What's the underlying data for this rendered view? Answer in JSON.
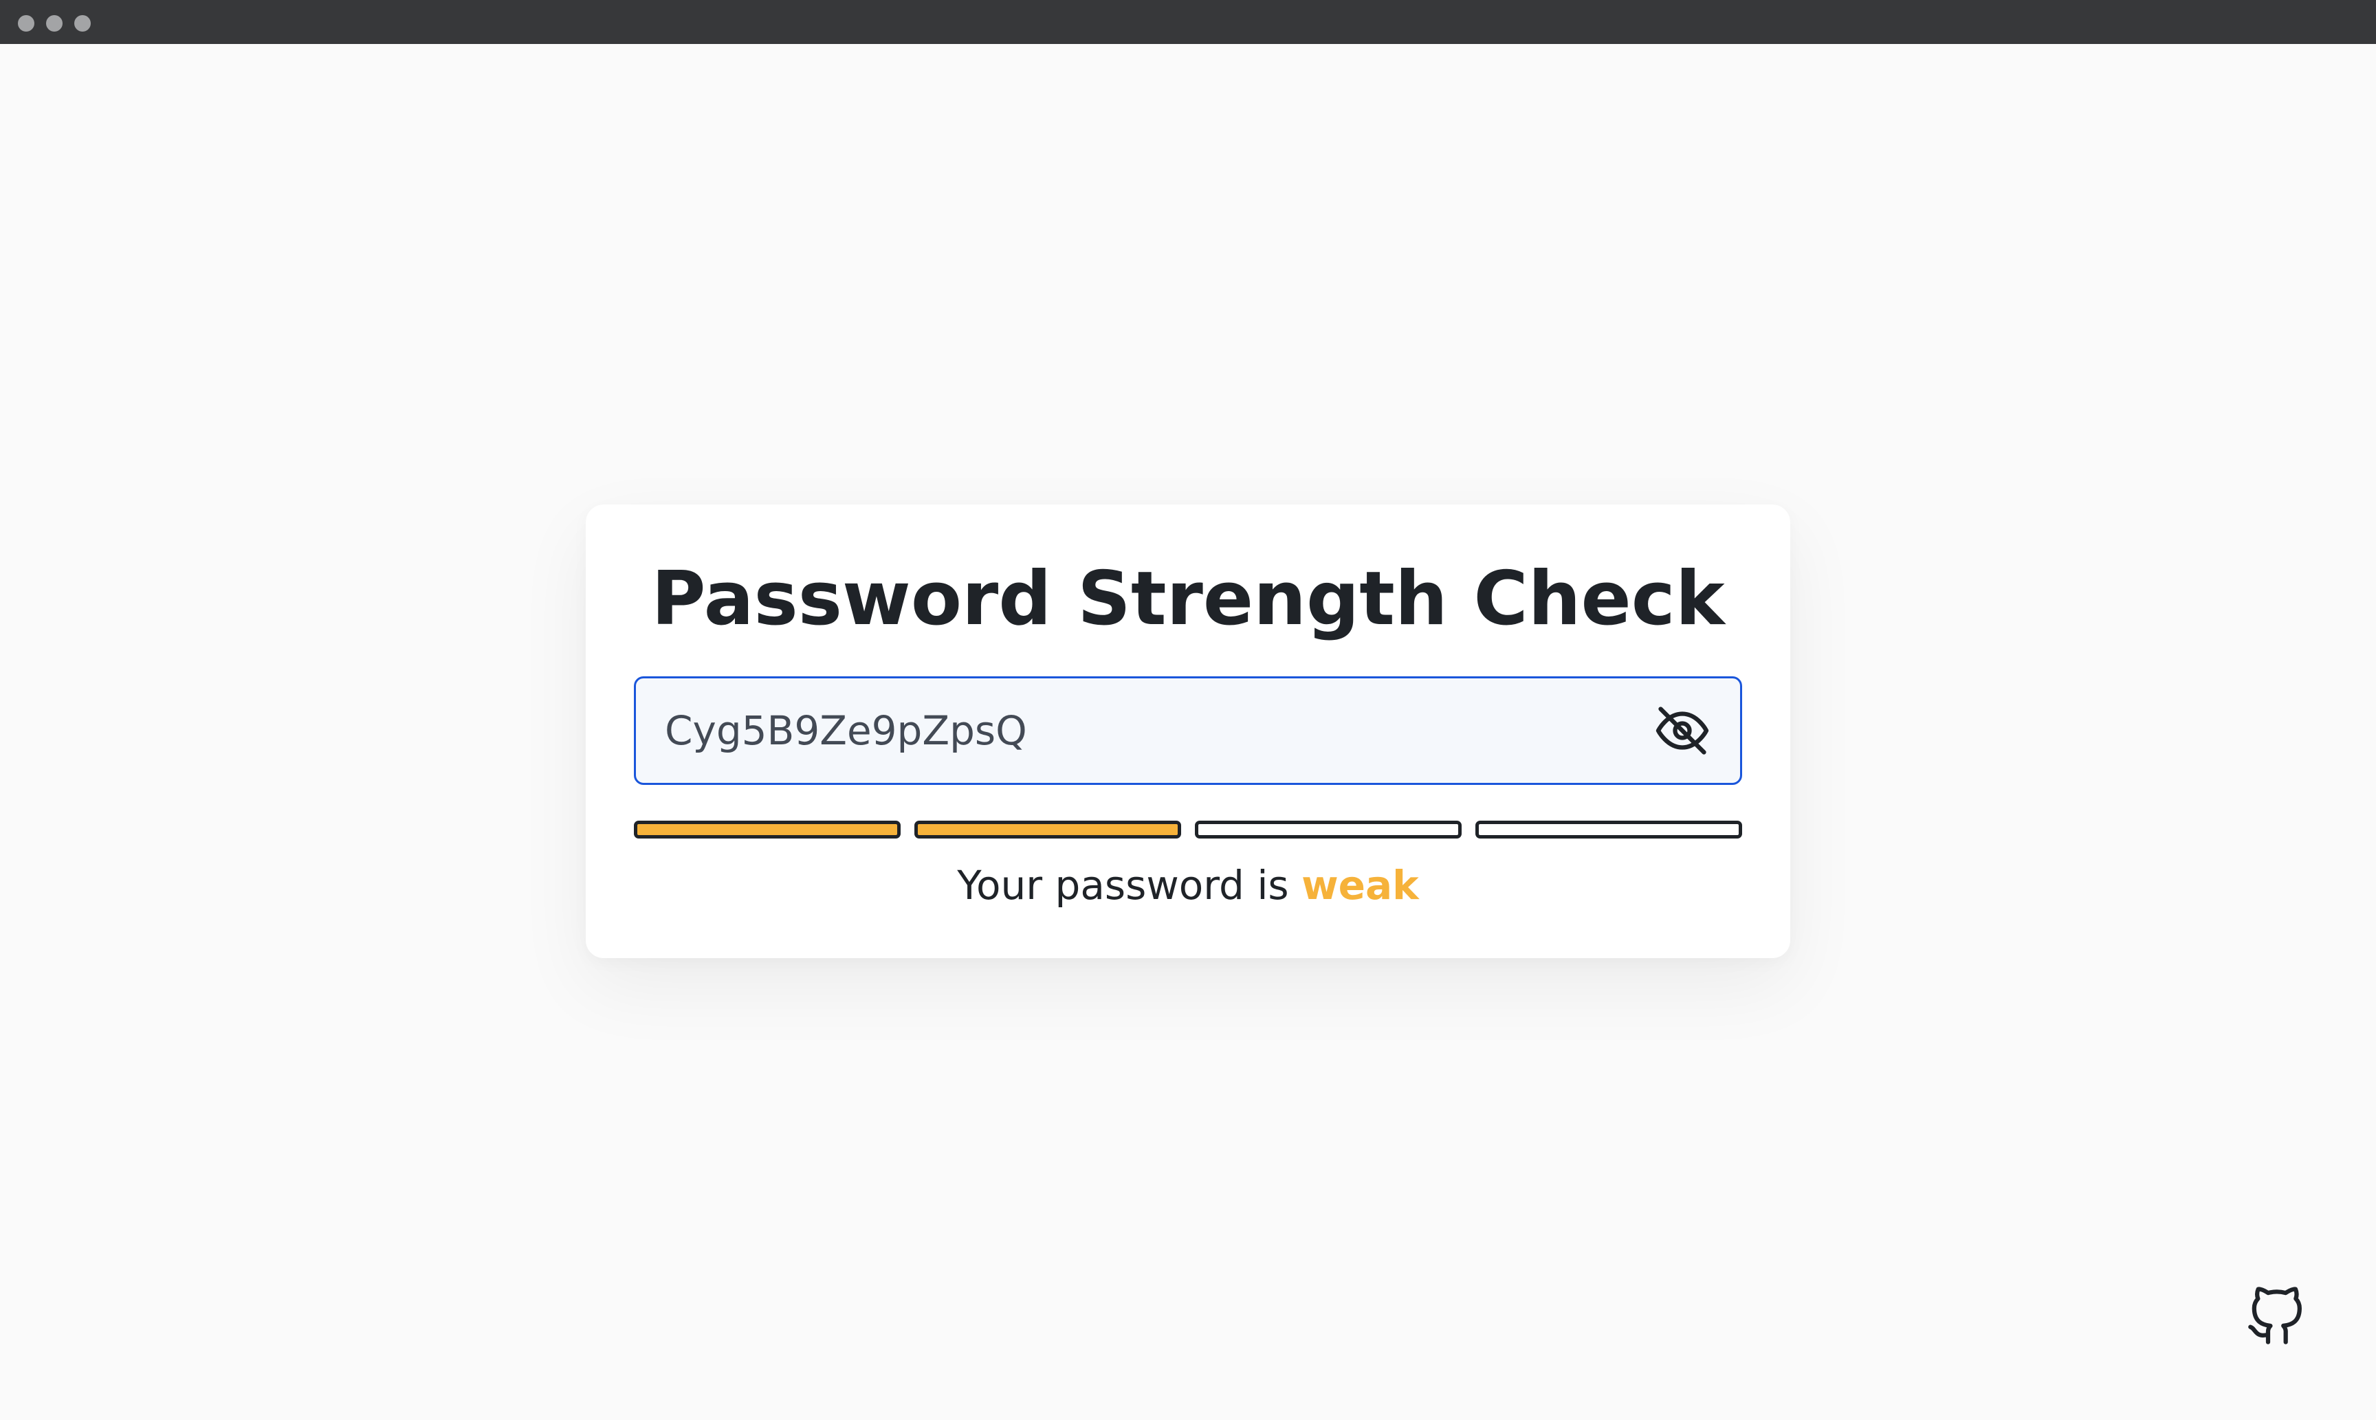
{
  "window": {
    "controls": [
      "window-dot",
      "window-dot",
      "window-dot"
    ]
  },
  "card": {
    "title": "Password Strength Check",
    "password_value": "Cyg5B9Ze9pZpsQ",
    "visibility_icon": "eye-off-icon",
    "strength": {
      "level": 2,
      "total": 4,
      "prefix": "Your password is ",
      "word": "weak"
    }
  },
  "colors": {
    "accent_border": "#1a56db",
    "weak": "#f6b23a",
    "empty_bar": "#ffffff"
  },
  "footer": {
    "link_icon": "github-icon"
  }
}
